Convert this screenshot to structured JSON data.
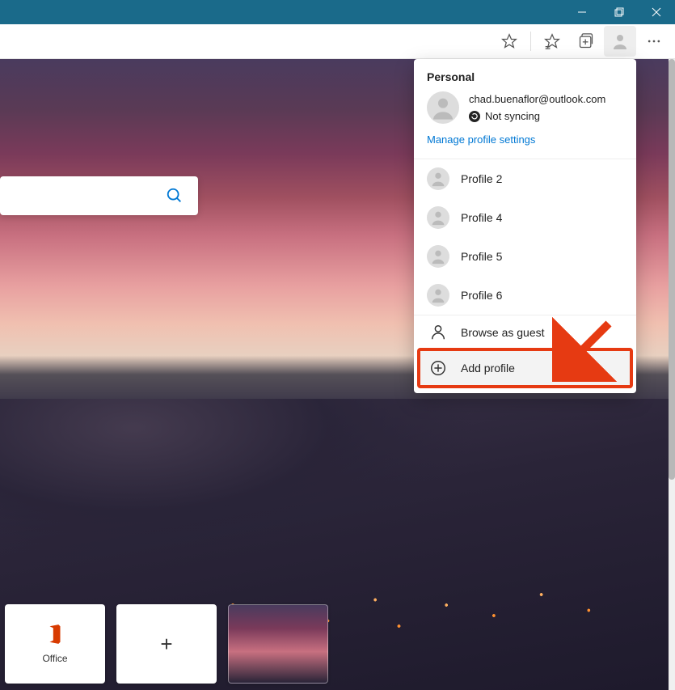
{
  "window": {
    "minimize_label": "Minimize",
    "maximize_label": "Restore",
    "close_label": "Close"
  },
  "toolbar": {
    "favorite_label": "Add to favorites",
    "favorites_list_label": "Favorites",
    "collections_label": "Collections",
    "profile_label": "Profile",
    "menu_label": "Settings and more"
  },
  "flyout": {
    "heading": "Personal",
    "email": "chad.buenaflor@outlook.com",
    "sync_status": "Not syncing",
    "manage_link": "Manage profile settings",
    "profiles": [
      {
        "label": "Profile 2"
      },
      {
        "label": "Profile 4"
      },
      {
        "label": "Profile 5"
      },
      {
        "label": "Profile 6"
      }
    ],
    "guest_label": "Browse as guest",
    "add_label": "Add profile"
  },
  "tiles": {
    "office": "Office",
    "add": "+"
  },
  "icons": {
    "search": "search-icon",
    "star": "star-icon"
  }
}
